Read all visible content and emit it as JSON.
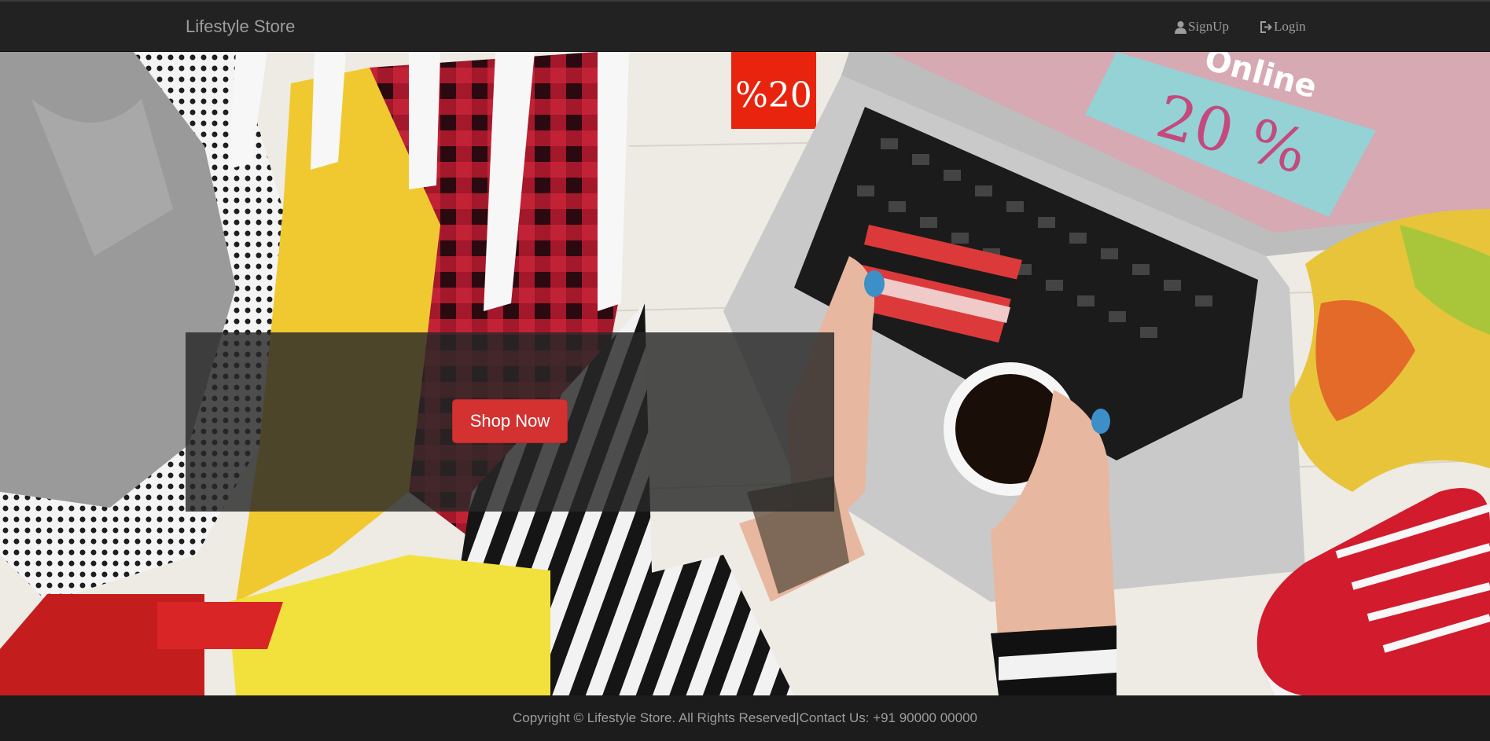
{
  "navbar": {
    "brand": "Lifestyle Store",
    "signup_label": "SignUp",
    "login_label": "Login",
    "signup_icon": "user-icon",
    "login_icon": "log-in-icon"
  },
  "hero": {
    "image": "shopping-flatlay-photo",
    "sale_tag_text": "%20",
    "screen_text_top": "Online",
    "screen_text_main": "20 %",
    "shop_button_label": "Shop Now"
  },
  "footer": {
    "text": "Copyright © Lifestyle Store. All Rights Reserved|Contact Us: +91 90000 00000"
  },
  "colors": {
    "navbar_bg": "#222222",
    "accent": "#d43131",
    "footer_bg": "#1c1c1c",
    "nav_text": "#9d9d9d"
  }
}
